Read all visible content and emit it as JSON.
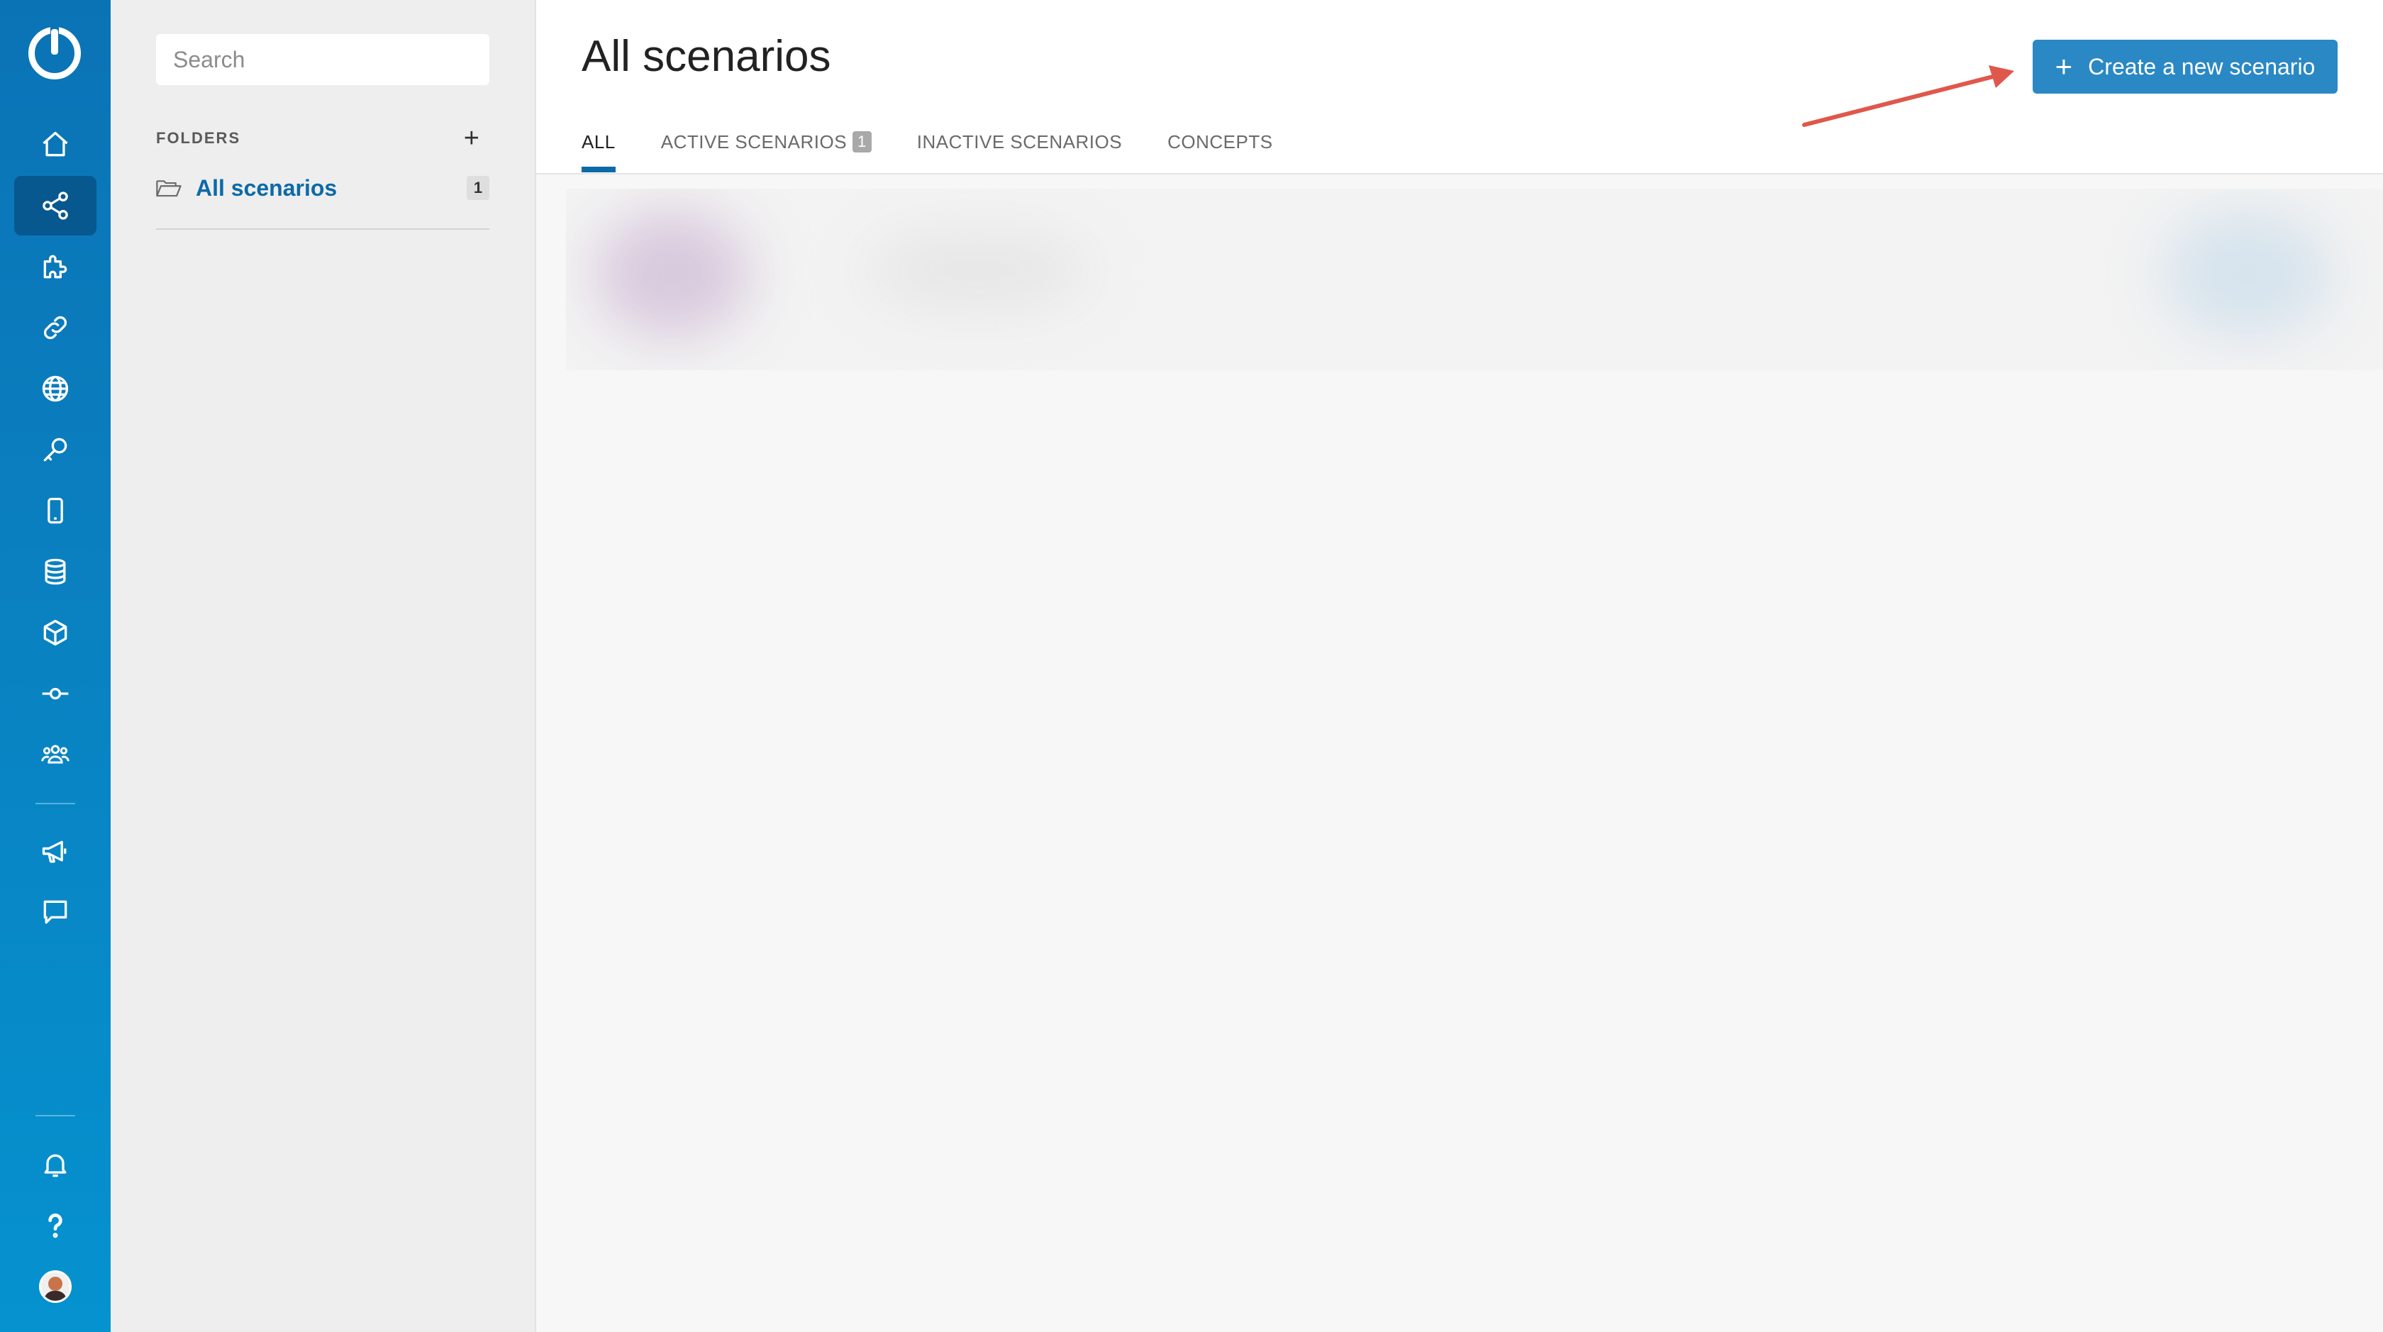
{
  "rail": {
    "nav": [
      {
        "icon": "home-icon",
        "active": false
      },
      {
        "icon": "scenarios-share-icon",
        "active": true
      },
      {
        "icon": "puzzle-icon",
        "active": false
      },
      {
        "icon": "link-icon",
        "active": false
      },
      {
        "icon": "globe-icon",
        "active": false
      },
      {
        "icon": "key-icon",
        "active": false
      },
      {
        "icon": "mobile-device-icon",
        "active": false
      },
      {
        "icon": "database-icon",
        "active": false
      },
      {
        "icon": "box-icon",
        "active": false
      },
      {
        "icon": "commit-icon",
        "active": false
      },
      {
        "icon": "team-icon",
        "active": false
      },
      {
        "icon": "megaphone-icon",
        "active": false
      },
      {
        "icon": "chat-icon",
        "active": false
      }
    ],
    "bottom": [
      "bell-icon",
      "help-icon",
      "avatar"
    ]
  },
  "folders_panel": {
    "search_placeholder": "Search",
    "folders_label": "FOLDERS",
    "add_label": "+",
    "items": [
      {
        "name": "All scenarios",
        "count": "1"
      }
    ]
  },
  "main": {
    "title": "All scenarios",
    "create_button": {
      "icon": "+",
      "label": "Create a new scenario"
    },
    "tabs": [
      {
        "label": "ALL",
        "active": true
      },
      {
        "label": "ACTIVE SCENARIOS",
        "badge": "1",
        "active": false
      },
      {
        "label": "INACTIVE SCENARIOS",
        "active": false
      },
      {
        "label": "CONCEPTS",
        "active": false
      }
    ]
  },
  "colors": {
    "rail": "#0a7fbf",
    "rail_active": "#07588f",
    "accent": "#0d6aa8",
    "button": "#2a88c5",
    "annotation_arrow": "#e0574b"
  }
}
